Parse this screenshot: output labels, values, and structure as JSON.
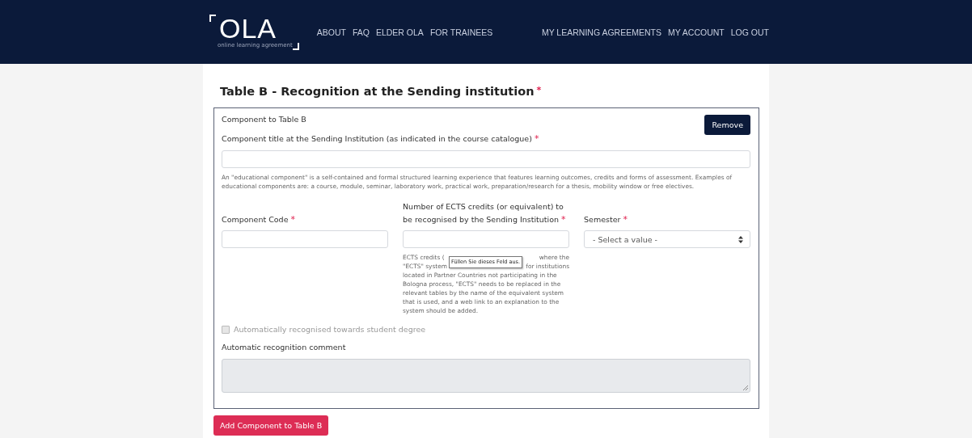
{
  "header": {
    "logo": "OLA",
    "logo_tagline": "online learning agreement",
    "nav_left": [
      "ABOUT",
      "FAQ",
      "ELDER OLA",
      "FOR TRAINEES"
    ],
    "nav_right": [
      "MY LEARNING AGREEMENTS",
      "MY ACCOUNT",
      "LOG OUT"
    ]
  },
  "section": {
    "title": "Table B - Recognition at the Sending institution",
    "required_mark": "*"
  },
  "component": {
    "heading": "Component to Table B",
    "remove_button": "Remove",
    "title_field": {
      "label": "Component title at the Sending Institution (as indicated in the course catalogue)",
      "required_mark": "*"
    },
    "title_help": "An \"educational component\" is a self-contained and formal structured learning experience that features learning outcomes, credits and forms of assessment. Examples of educational components are: a course, module, seminar, laboratory work, practical work, preparation/research for a thesis, mobility window or free electives.",
    "code_field": {
      "label": "Component Code",
      "required_mark": "*"
    },
    "ects_field": {
      "label": "Number of ECTS credits (or equivalent) to be recognised by the Sending Institution",
      "required_mark": "*"
    },
    "ects_help_covered": [
      [
        "ECTS credits (",
        "where the"
      ],
      [
        "\"ECTS\" system",
        "for institutions"
      ]
    ],
    "ects_help_rest": "located in Partner Countries not participating in the Bologna process, \"ECTS\" needs to be replaced in the relevant tables by the name of the equivalent system that is used, and a web link to an explanation to the system should be added.",
    "tooltip": "Füllen Sie dieses Feld aus.",
    "semester_field": {
      "label": "Semester",
      "required_mark": "*",
      "placeholder": "- Select a value -"
    },
    "auto_checkbox": {
      "label": "Automatically recognised towards student degree",
      "checked": false,
      "disabled": true
    },
    "comment_field": {
      "label": "Automatic recognition comment",
      "disabled": true
    }
  },
  "add_button": "Add Component to Table B"
}
